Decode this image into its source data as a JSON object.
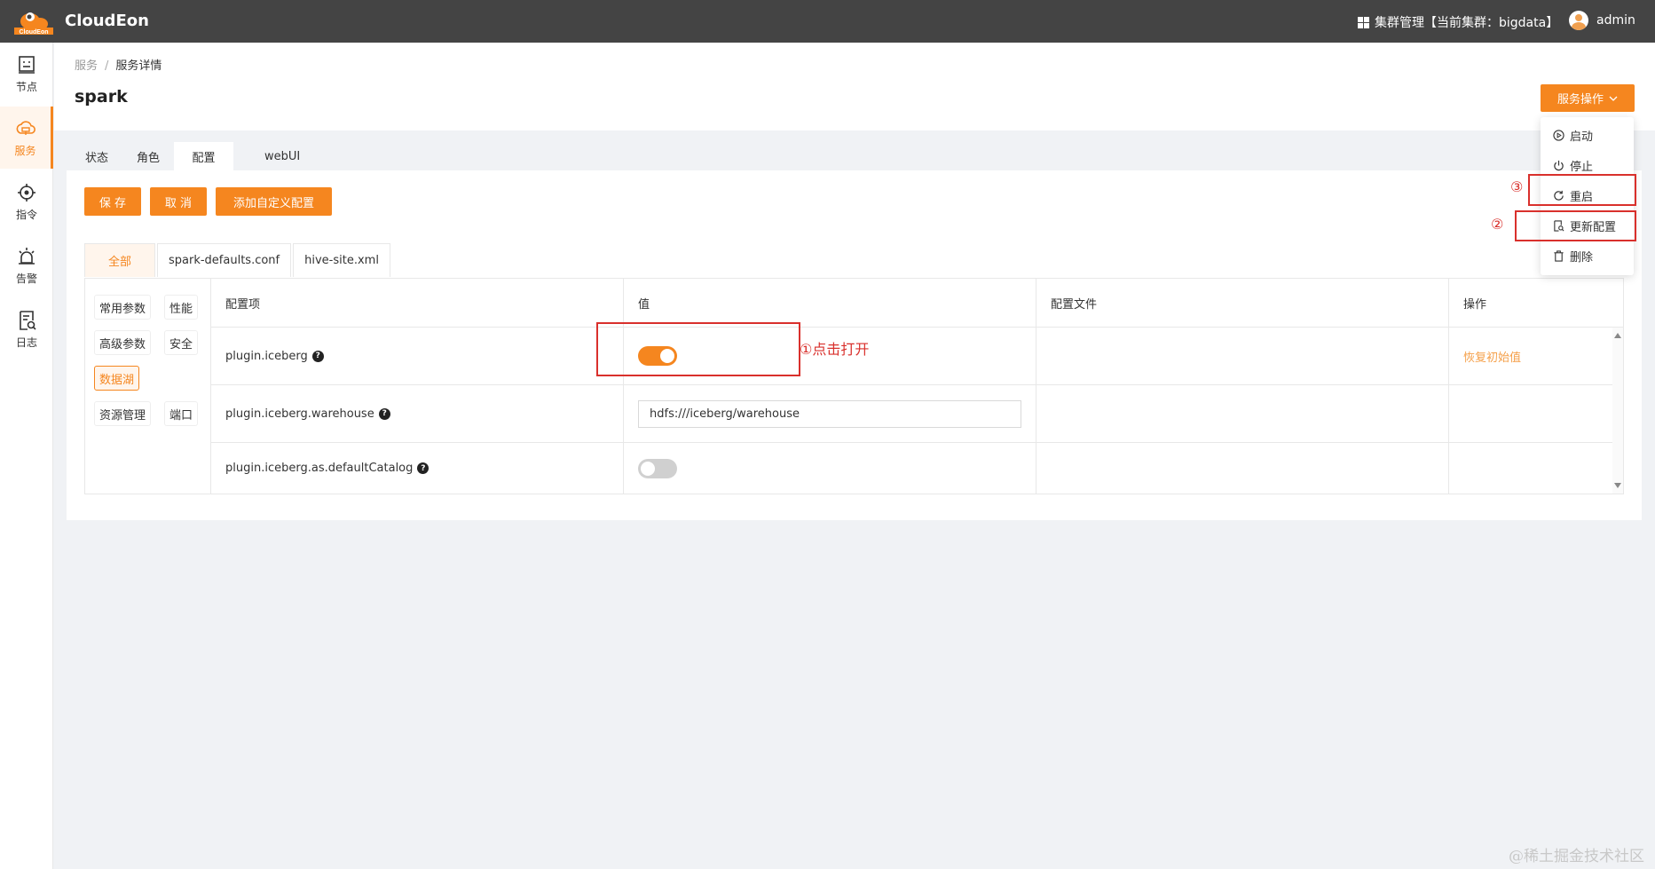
{
  "app": {
    "brand": "CloudEon",
    "logo_text": "CloudEon"
  },
  "topbar": {
    "cluster_label": "集群管理【当前集群：bigdata】",
    "user_name": "admin"
  },
  "sidebar": {
    "items": [
      {
        "label": "节点",
        "icon": "node-icon",
        "active": false
      },
      {
        "label": "服务",
        "icon": "service-icon",
        "active": true
      },
      {
        "label": "指令",
        "icon": "command-icon",
        "active": false
      },
      {
        "label": "告警",
        "icon": "alarm-icon",
        "active": false
      },
      {
        "label": "日志",
        "icon": "log-icon",
        "active": false
      }
    ]
  },
  "breadcrumb": {
    "parent": "服务",
    "separator": "/",
    "current": "服务详情"
  },
  "page": {
    "title": "spark"
  },
  "service_ops": {
    "button_label": "服务操作",
    "items": [
      {
        "label": "启动",
        "icon": "play-circle-icon"
      },
      {
        "label": "停止",
        "icon": "power-icon"
      },
      {
        "label": "重启",
        "icon": "reload-icon"
      },
      {
        "label": "更新配置",
        "icon": "file-search-icon"
      },
      {
        "label": "删除",
        "icon": "trash-icon"
      }
    ]
  },
  "tabs": [
    {
      "label": "状态",
      "active": false
    },
    {
      "label": "角色",
      "active": false
    },
    {
      "label": "配置",
      "active": true
    },
    {
      "label": "webUI",
      "active": false
    }
  ],
  "actions": {
    "save": "保 存",
    "cancel": "取 消",
    "add_custom": "添加自定义配置"
  },
  "file_tabs": [
    {
      "label": "全部",
      "active": true
    },
    {
      "label": "spark-defaults.conf",
      "active": false
    },
    {
      "label": "hive-site.xml",
      "active": false
    }
  ],
  "categories": [
    {
      "label": "常用参数",
      "active": false
    },
    {
      "label": "性能",
      "active": false
    },
    {
      "label": "高级参数",
      "active": false
    },
    {
      "label": "安全",
      "active": false
    },
    {
      "label": "数据湖",
      "active": true
    },
    {
      "label": "资源管理",
      "active": false
    },
    {
      "label": "端口",
      "active": false
    }
  ],
  "table": {
    "columns": [
      "配置项",
      "值",
      "配置文件",
      "操作"
    ],
    "rows": [
      {
        "name": "plugin.iceberg",
        "value_type": "toggle",
        "value": true,
        "file": "",
        "action": "恢复初始值"
      },
      {
        "name": "plugin.iceberg.warehouse",
        "value_type": "input",
        "value": "hdfs:///iceberg/warehouse",
        "file": "",
        "action": ""
      },
      {
        "name": "plugin.iceberg.as.defaultCatalog",
        "value_type": "toggle",
        "value": false,
        "file": "",
        "action": ""
      }
    ]
  },
  "annotations": {
    "step1": "①点击打开",
    "step2": "②",
    "step3": "③"
  },
  "watermark": "@稀土掘金技术社区",
  "colors": {
    "accent": "#f5861f",
    "topbar": "#444444",
    "annotation": "#d9302c"
  }
}
